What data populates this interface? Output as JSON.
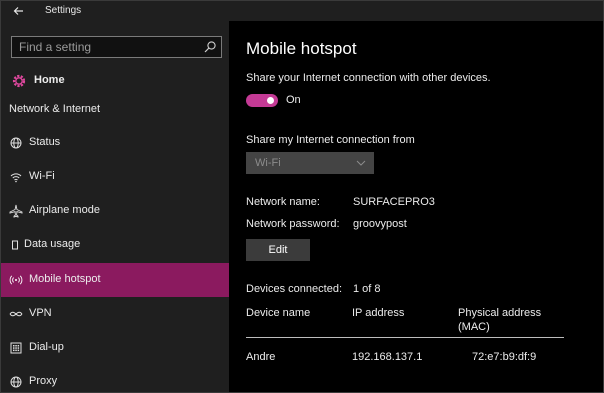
{
  "window": {
    "title": "Settings"
  },
  "sidebar": {
    "search": {
      "placeholder": "Find a setting",
      "value": ""
    },
    "home_label": "Home",
    "section_label": "Network & Internet",
    "items": [
      {
        "label": "Status",
        "icon": "globe-icon",
        "active": false
      },
      {
        "label": "Wi-Fi",
        "icon": "wifi-icon",
        "active": false
      },
      {
        "label": "Airplane mode",
        "icon": "airplane-icon",
        "active": false
      },
      {
        "label": "Data usage",
        "icon": "data-usage-icon",
        "active": false
      },
      {
        "label": "Mobile hotspot",
        "icon": "hotspot-icon",
        "active": true
      },
      {
        "label": "VPN",
        "icon": "vpn-icon",
        "active": false
      },
      {
        "label": "Dial-up",
        "icon": "dialup-icon",
        "active": false
      },
      {
        "label": "Proxy",
        "icon": "globe-icon",
        "active": false
      }
    ]
  },
  "main": {
    "title": "Mobile hotspot",
    "share_description": "Share your Internet connection with other devices.",
    "toggle_state": "On",
    "share_from_label": "Share my Internet connection from",
    "share_from_value": "Wi-Fi",
    "network_name_label": "Network name:",
    "network_name_value": "SURFACEPRO3",
    "network_password_label": "Network password:",
    "network_password_value": "groovypost",
    "edit_label": "Edit",
    "devices_connected_label": "Devices connected:",
    "devices_connected_value": "1 of 8",
    "table": {
      "headers": [
        "Device name",
        "IP address",
        "Physical address (MAC)"
      ],
      "rows": [
        [
          "Andre",
          "192.168.137.1",
          "72:e7:b9:df:9"
        ]
      ]
    }
  },
  "colors": {
    "accent": "#8b1a5f",
    "toggle_on": "#c43a95",
    "sidebar_bg": "#1f1f1f",
    "content_bg": "#000000"
  }
}
